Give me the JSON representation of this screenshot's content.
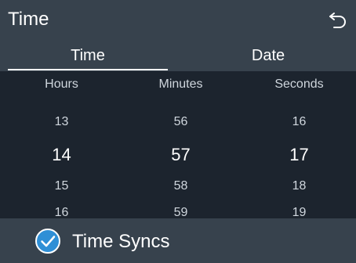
{
  "header": {
    "title": "Time",
    "back_icon": "back-arrow-icon"
  },
  "tabs": [
    {
      "label": "Time",
      "selected": true
    },
    {
      "label": "Date",
      "selected": false
    }
  ],
  "picker": {
    "hours": {
      "label": "Hours",
      "values": [
        "13",
        "14",
        "15",
        "16"
      ],
      "selected": "14"
    },
    "minutes": {
      "label": "Minutes",
      "values": [
        "56",
        "57",
        "58",
        "59"
      ],
      "selected": "57"
    },
    "seconds": {
      "label": "Seconds",
      "values": [
        "16",
        "17",
        "18",
        "19"
      ],
      "selected": "17"
    }
  },
  "footer": {
    "sync_label": "Time Syncs",
    "sync_checked": true,
    "accent_color": "#2f8fd6"
  },
  "colors": {
    "bar_background": "#37424d",
    "picker_background": "#1c242e"
  }
}
